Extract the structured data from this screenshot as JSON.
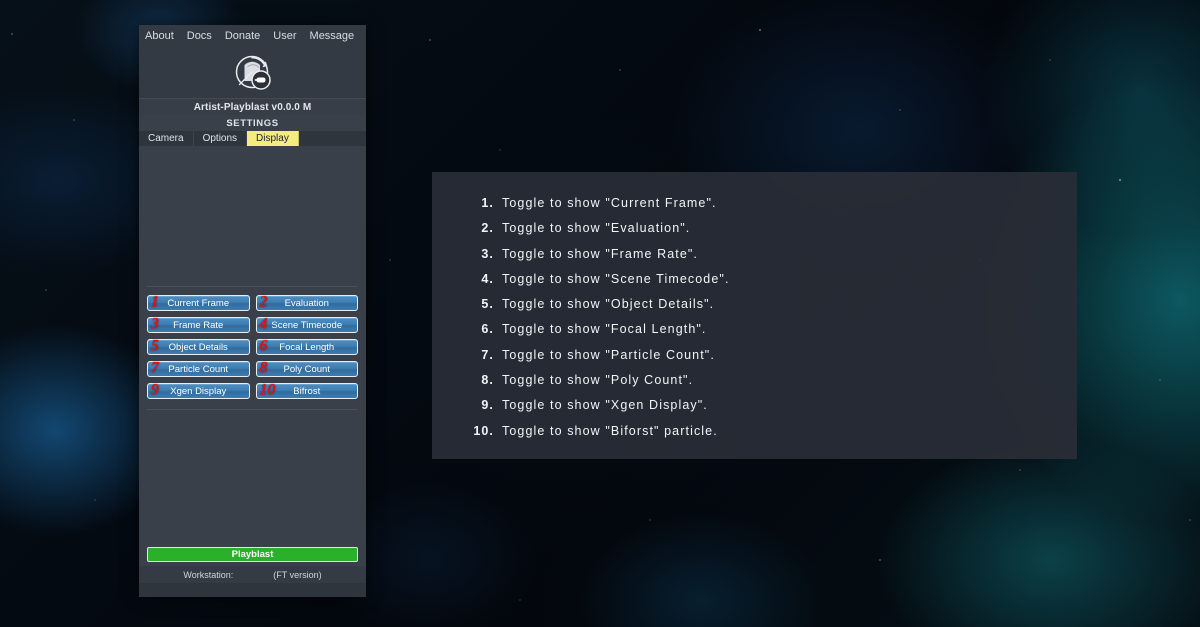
{
  "app": {
    "menu": [
      "About",
      "Docs",
      "Donate",
      "User",
      "Message"
    ],
    "logo_icon": "playblast-camera-logo-icon",
    "title": "Artist-Playblast v0.0.0 M",
    "settings_label": "SETTINGS",
    "tabs": [
      {
        "label": "Camera",
        "active": false
      },
      {
        "label": "Options",
        "active": false
      },
      {
        "label": "Display",
        "active": true
      }
    ],
    "toggles": [
      {
        "num": "1",
        "label": "Current Frame"
      },
      {
        "num": "2",
        "label": "Evaluation"
      },
      {
        "num": "3",
        "label": "Frame Rate"
      },
      {
        "num": "4",
        "label": "Scene Timecode"
      },
      {
        "num": "5",
        "label": "Object Details"
      },
      {
        "num": "6",
        "label": "Focal Length"
      },
      {
        "num": "7",
        "label": "Particle Count"
      },
      {
        "num": "8",
        "label": "Poly Count"
      },
      {
        "num": "9",
        "label": "Xgen Display"
      },
      {
        "num": "10",
        "label": "Bifrost"
      }
    ],
    "playblast_label": "Playblast",
    "status": {
      "workstation_label": "Workstation:",
      "version_label": "(FT version)"
    }
  },
  "instructions": [
    {
      "num": "1.",
      "text": "Toggle to show \"Current Frame\"."
    },
    {
      "num": "2.",
      "text": "Toggle to show \"Evaluation\"."
    },
    {
      "num": "3.",
      "text": "Toggle to show \"Frame Rate\"."
    },
    {
      "num": "4.",
      "text": "Toggle to show \"Scene Timecode\"."
    },
    {
      "num": "5.",
      "text": "Toggle to show \"Object Details\"."
    },
    {
      "num": "6.",
      "text": "Toggle to show \"Focal Length\"."
    },
    {
      "num": "7.",
      "text": "Toggle to show \"Particle Count\"."
    },
    {
      "num": "8.",
      "text": "Toggle to show \"Poly Count\"."
    },
    {
      "num": "9.",
      "text": "Toggle to show \"Xgen Display\"."
    },
    {
      "num": "10.",
      "text": "Toggle to show \"Biforst\" particle."
    }
  ],
  "colors": {
    "panel_bg": "#3a4049",
    "tab_active": "#f3ec80",
    "toggle_blue": "#3f7db1",
    "playblast_green": "#2bb02b",
    "annotation_red": "#ee0b0b"
  }
}
